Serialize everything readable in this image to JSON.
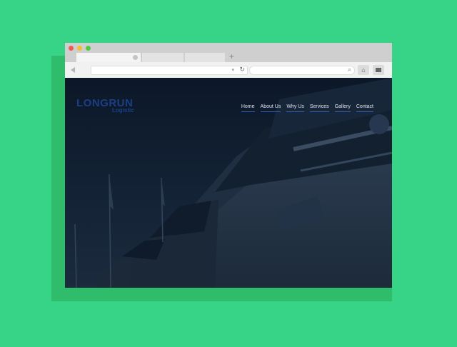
{
  "browser": {
    "tabs": [
      "",
      "",
      ""
    ],
    "url": "",
    "search": ""
  },
  "site": {
    "logo": {
      "main": "LONGRUN",
      "sub": "Logistic"
    },
    "nav": [
      "Home",
      "About Us",
      "Why Us",
      "Services",
      "Gallery",
      "Contact"
    ]
  },
  "colors": {
    "background": "#37d386",
    "hero_dark": "#0e1b2c",
    "logo": "#1a3f86",
    "nav_underline": "#2f5fb3"
  },
  "icons": [
    "back-arrow-icon",
    "reload-icon",
    "search-icon",
    "home-icon",
    "menu-icon",
    "new-tab-icon"
  ]
}
